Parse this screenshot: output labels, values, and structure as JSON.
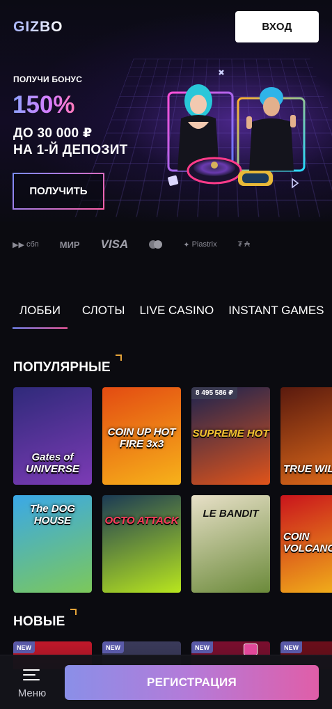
{
  "header": {
    "logo": "GIZBO",
    "login_label": "ВХОД"
  },
  "promo": {
    "pre_title": "ПОЛУЧИ БОНУС",
    "percent": "150%",
    "line1": "ДО 30 000 ₽",
    "line2": "НА 1-Й ДЕПОЗИТ",
    "cta_label": "ПОЛУЧИТЬ"
  },
  "payments": [
    {
      "name": "sbp-logo",
      "label": "сбп"
    },
    {
      "name": "mir-logo",
      "label": "МИР"
    },
    {
      "name": "visa-logo",
      "label": "VISA"
    },
    {
      "name": "mastercard-logo",
      "label": ""
    },
    {
      "name": "piastrix-logo",
      "label": "Piastrix"
    },
    {
      "name": "crypto-logo",
      "label": "₮ ₳"
    }
  ],
  "tabs": [
    {
      "label": "ЛОББИ",
      "active": true
    },
    {
      "label": "СЛОТЫ",
      "active": false
    },
    {
      "label": "LIVE CASINO",
      "active": false
    },
    {
      "label": "INSTANT GAMES",
      "active": false
    }
  ],
  "popular": {
    "title": "ПОПУЛЯРНЫЕ",
    "row1": [
      {
        "title": "Gates of UNIVERSE",
        "colors": [
          "#2f2a7a",
          "#7c3bb5"
        ]
      },
      {
        "title": "COIN UP HOT FIRE 3x3",
        "colors": [
          "#e34b12",
          "#f7b21a"
        ]
      },
      {
        "title": "SUPREME HOT",
        "jackpot": "8 495 586 ₽",
        "colors": [
          "#1b2350",
          "#e0541a"
        ]
      },
      {
        "title": "TRUE WILD",
        "colors": [
          "#5a1a0e",
          "#e36d1a"
        ]
      }
    ],
    "row2": [
      {
        "title": "The DOG HOUSE",
        "colors": [
          "#3aa8e8",
          "#7cc85a"
        ]
      },
      {
        "title": "OCTO ATTACK",
        "colors": [
          "#1b3a55",
          "#b8e61e"
        ]
      },
      {
        "title": "LE BANDIT",
        "colors": [
          "#e8e0c8",
          "#6b8a3a"
        ]
      },
      {
        "title": "COIN VOLCANO",
        "colors": [
          "#c9141c",
          "#f4b91a"
        ]
      }
    ]
  },
  "new_games": {
    "title": "НОВЫЕ",
    "badge": "NEW",
    "cards": [
      {
        "colors": [
          "#c0182a",
          "#3a0a12"
        ]
      },
      {
        "colors": [
          "#3a3a5a",
          "#1a1a2a"
        ]
      },
      {
        "colors": [
          "#7a0e2e",
          "#2a0a16"
        ]
      },
      {
        "colors": [
          "#6a0e1a",
          "#2a0a10"
        ]
      }
    ]
  },
  "bottom": {
    "menu_label": "Меню",
    "register_label": "РЕГИСТРАЦИЯ"
  }
}
